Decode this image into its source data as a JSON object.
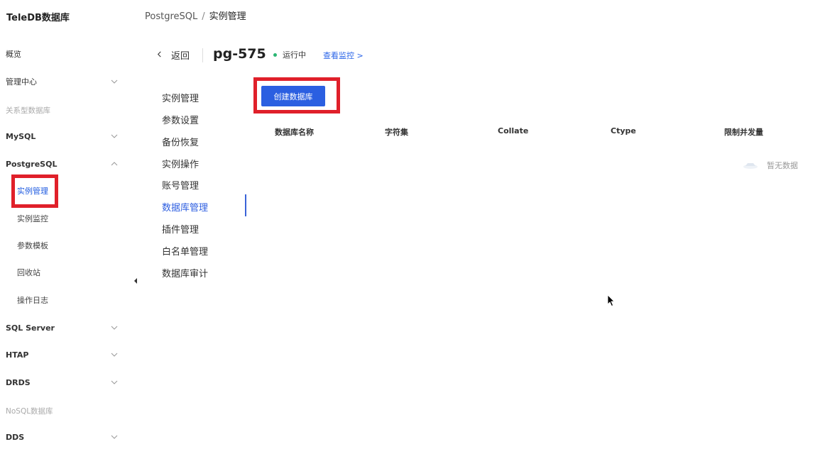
{
  "app": {
    "brand": "TeleDB数据库"
  },
  "sidebar": {
    "overview": "概览",
    "management_center": "管理中心",
    "group_relational": "关系型数据库",
    "mysql": "MySQL",
    "postgresql": "PostgreSQL",
    "pg_items": [
      {
        "label": "实例管理",
        "active": true
      },
      {
        "label": "实例监控"
      },
      {
        "label": "参数模板"
      },
      {
        "label": "回收站"
      },
      {
        "label": "操作日志"
      }
    ],
    "sqlserver": "SQL Server",
    "htap": "HTAP",
    "drds": "DRDS",
    "group_nosql": "NoSQL数据库",
    "dds": "DDS"
  },
  "breadcrumb": {
    "parent": "PostgreSQL",
    "separator": "/",
    "current": "实例管理"
  },
  "header": {
    "back_label": "返回",
    "instance_name": "pg-575",
    "status": "运行中",
    "monitor_link": "查看监控 >"
  },
  "submenu": [
    {
      "label": "实例管理"
    },
    {
      "label": "参数设置"
    },
    {
      "label": "备份恢复"
    },
    {
      "label": "实例操作"
    },
    {
      "label": "账号管理"
    },
    {
      "label": "数据库管理",
      "active": true
    },
    {
      "label": "插件管理"
    },
    {
      "label": "白名单管理"
    },
    {
      "label": "数据库审计"
    }
  ],
  "toolbar": {
    "create_label": "创建数据库"
  },
  "table": {
    "columns": [
      "数据库名称",
      "字符集",
      "Collate",
      "Ctype",
      "限制并发量"
    ],
    "empty_text": "暂无数据"
  },
  "colors": {
    "accent": "#2b5fe1",
    "highlight": "#e0202a",
    "status_ok": "#2bb673"
  }
}
